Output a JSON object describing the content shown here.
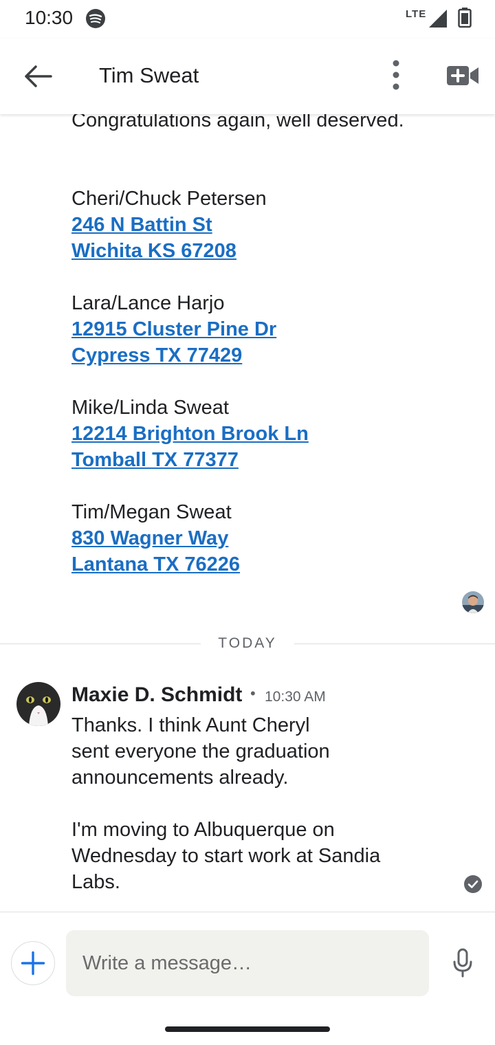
{
  "status_bar": {
    "time": "10:30",
    "network": "LTE",
    "icons": [
      "spotify-icon",
      "signal-icon",
      "battery-icon"
    ]
  },
  "app_bar": {
    "title": "Tim Sweat",
    "icons": [
      "back-arrow-icon",
      "more-vert-icon",
      "video-call-icon"
    ]
  },
  "thread": {
    "previous_message": {
      "line": "Congratulations again, well deserved.",
      "addresses": [
        {
          "name": "Cheri/Chuck Petersen",
          "street": "246 N Battin St",
          "city": "Wichita KS 67208"
        },
        {
          "name": "Lara/Lance Harjo",
          "street": "12915 Cluster Pine Dr",
          "city": "Cypress TX 77429"
        },
        {
          "name": "Mike/Linda Sweat",
          "street": "12214 Brighton Brook Ln",
          "city": "Tomball TX 77377"
        },
        {
          "name": "Tim/Megan Sweat",
          "street": "830 Wagner Way",
          "city": "Lantana TX 76226"
        }
      ]
    },
    "day_divider": "TODAY",
    "reply": {
      "sender": "Maxie D. Schmidt",
      "separator": "•",
      "time": "10:30 AM",
      "text": "Thanks. I think Aunt Cheryl\nsent everyone the graduation\nannouncements already.\n\nI'm moving to Albuquerque on\nWednesday to start work at Sandia\nLabs."
    }
  },
  "composer": {
    "placeholder": "Write a message…"
  },
  "colors": {
    "link": "#1a6ec4",
    "accent": "#1a73e8",
    "text": "#202124",
    "muted": "#5f6368",
    "input_bg": "#f1f1ee"
  }
}
